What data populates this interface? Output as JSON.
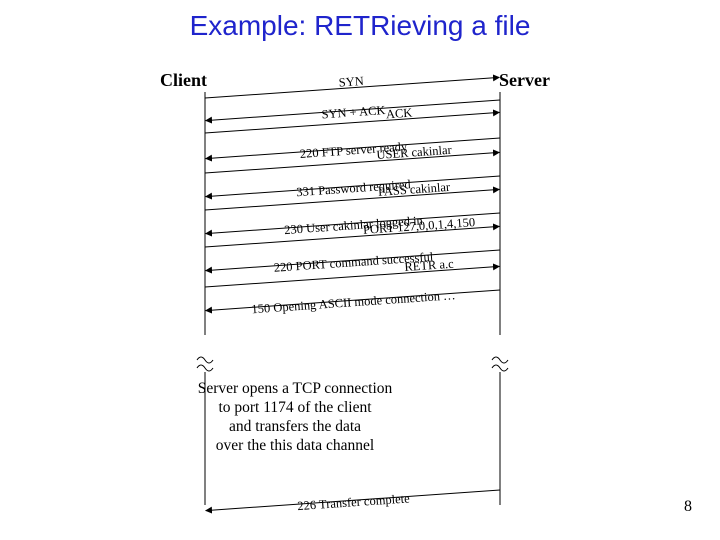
{
  "title": "Example: RETRieving a file",
  "participants": {
    "client": "Client",
    "server": "Server"
  },
  "page_number": "8",
  "messages": {
    "syn": "SYN",
    "synack": "SYN + ACK",
    "ack": "ACK",
    "ftp_ready": "220 FTP server ready",
    "user": "USER cakinlar",
    "pwreq": "331 Password required",
    "pass": "PASS cakinlar",
    "loggedin": "230 User cakinlar logged in",
    "port": "PORT 127,0,0,1,4,150",
    "port_ok": "220 PORT command successful",
    "retr": "RETR a.c",
    "opening": "150 Opening ASCII mode connection …",
    "xfer_done": "226 Transfer complete"
  },
  "note": "Server opens a TCP connection\nto port 1174 of the client\nand transfers the data\nover the this data channel"
}
